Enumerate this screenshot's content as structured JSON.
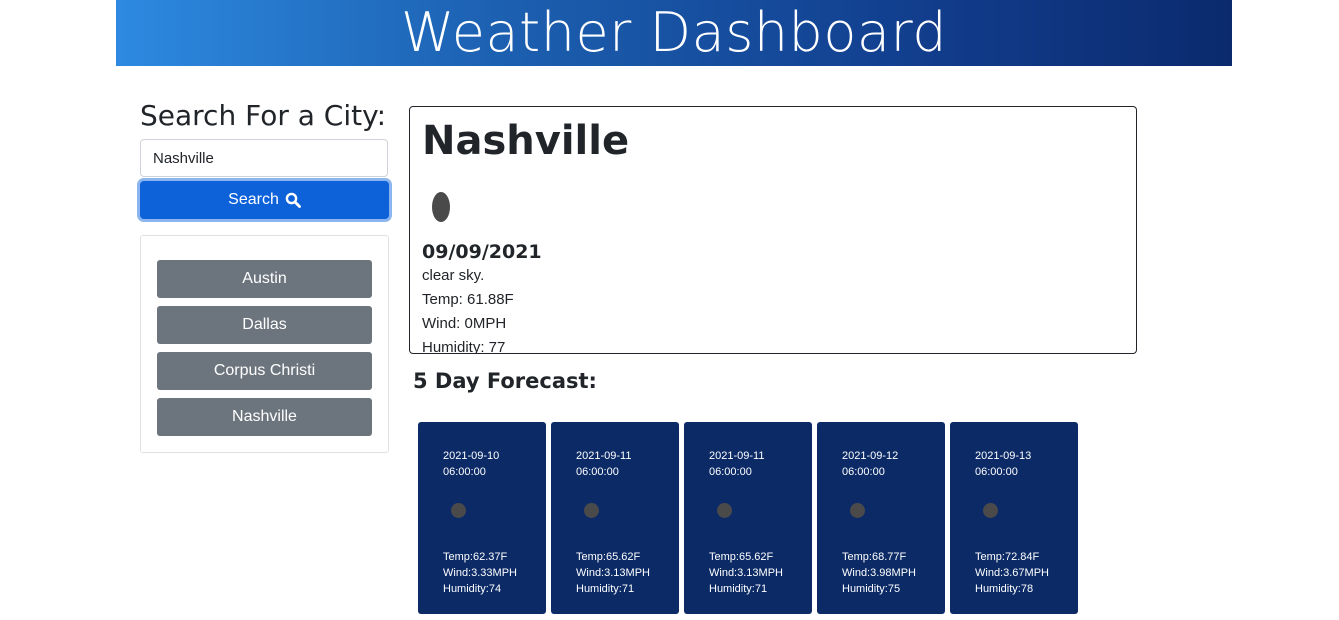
{
  "header": {
    "title": "Weather Dashboard"
  },
  "search": {
    "title": "Search For a City:",
    "input_value": "Nashville",
    "button_label": "Search"
  },
  "history": [
    "Austin",
    "Dallas",
    "Corpus Christi",
    "Nashville"
  ],
  "current": {
    "city": "Nashville",
    "date": "09/09/2021",
    "description": "clear sky.",
    "temp": "Temp: 61.88F",
    "wind": "Wind: 0MPH",
    "humidity": "Humidity: 77"
  },
  "forecast": {
    "title": "5 Day Forecast:",
    "days": [
      {
        "date": "2021-09-10",
        "time": "06:00:00",
        "temp": "Temp:62.37F",
        "wind": "Wind:3.33MPH",
        "humidity": "Humidity:74"
      },
      {
        "date": "2021-09-11",
        "time": "06:00:00",
        "temp": "Temp:65.62F",
        "wind": "Wind:3.13MPH",
        "humidity": "Humidity:71"
      },
      {
        "date": "2021-09-11",
        "time": "06:00:00",
        "temp": "Temp:65.62F",
        "wind": "Wind:3.13MPH",
        "humidity": "Humidity:71"
      },
      {
        "date": "2021-09-12",
        "time": "06:00:00",
        "temp": "Temp:68.77F",
        "wind": "Wind:3.98MPH",
        "humidity": "Humidity:75"
      },
      {
        "date": "2021-09-13",
        "time": "06:00:00",
        "temp": "Temp:72.84F",
        "wind": "Wind:3.67MPH",
        "humidity": "Humidity:78"
      }
    ]
  },
  "colors": {
    "header_start": "#2d8ae0",
    "header_end": "#0b2a6e",
    "primary_button": "#0d62d9",
    "history_button": "#6c757d",
    "forecast_card": "#0b2a66"
  },
  "icons": {
    "search_button": "search-icon",
    "weather": "weather-icon"
  }
}
